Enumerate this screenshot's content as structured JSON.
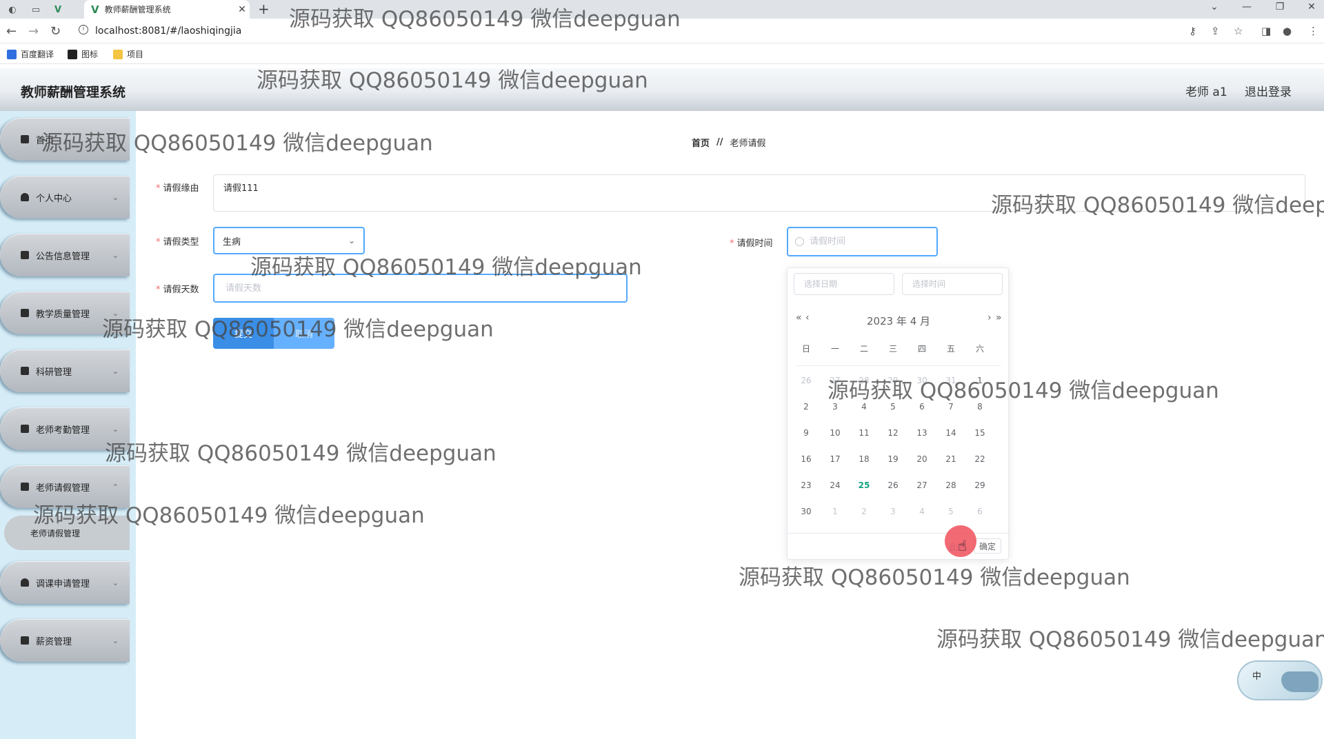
{
  "browser": {
    "tab_title": "教师薪酬管理系统",
    "url": "localhost:8081/#/laoshiqingjia",
    "bookmarks": [
      {
        "label": "百度翻译"
      },
      {
        "label": "图标"
      },
      {
        "label": "项目"
      }
    ]
  },
  "header": {
    "title": "教师薪酬管理系统",
    "user": "老师 a1",
    "logout": "退出登录"
  },
  "sidebar": {
    "items": [
      {
        "label": "首页"
      },
      {
        "label": "个人中心"
      },
      {
        "label": "公告信息管理"
      },
      {
        "label": "教学质量管理"
      },
      {
        "label": "科研管理"
      },
      {
        "label": "老师考勤管理"
      },
      {
        "label": "老师请假管理"
      },
      {
        "label": "调课申请管理"
      },
      {
        "label": "薪资管理"
      }
    ],
    "submenu_active": "老师请假管理"
  },
  "breadcrumb": {
    "home": "首页",
    "separator": "//",
    "current": "老师请假"
  },
  "form": {
    "reason_label": "请假缘由",
    "reason_value": "请假111",
    "type_label": "请假类型",
    "type_value": "生病",
    "days_label": "请假天数",
    "days_placeholder": "请假天数",
    "time_label": "请假时间",
    "time_placeholder": "请假时间",
    "submit": "提交",
    "cancel": "取消"
  },
  "date_picker": {
    "date_placeholder": "选择日期",
    "time_placeholder": "选择时间",
    "title": "2023 年  4 月",
    "prev_year": "«",
    "prev_month": "‹",
    "next_month": "›",
    "next_year": "»",
    "weekdays": [
      "日",
      "一",
      "二",
      "三",
      "四",
      "五",
      "六"
    ],
    "weeks": [
      [
        "26",
        "27",
        "28",
        "29",
        "30",
        "31",
        "1"
      ],
      [
        "2",
        "3",
        "4",
        "5",
        "6",
        "7",
        "8"
      ],
      [
        "9",
        "10",
        "11",
        "12",
        "13",
        "14",
        "15"
      ],
      [
        "16",
        "17",
        "18",
        "19",
        "20",
        "21",
        "22"
      ],
      [
        "23",
        "24",
        "25",
        "26",
        "27",
        "28",
        "29"
      ],
      [
        "30",
        "1",
        "2",
        "3",
        "4",
        "5",
        "6"
      ]
    ],
    "today": "25",
    "now_button": "此刻",
    "ok_button": "确定"
  },
  "ime_widget": {
    "label": "中"
  },
  "watermark": "源码获取 QQ86050149 微信deepguan",
  "colors": {
    "accent": "#409eff",
    "today": "#13a37f",
    "sidebar_bg": "#d6edf7",
    "required_star": "#f56c6c"
  }
}
